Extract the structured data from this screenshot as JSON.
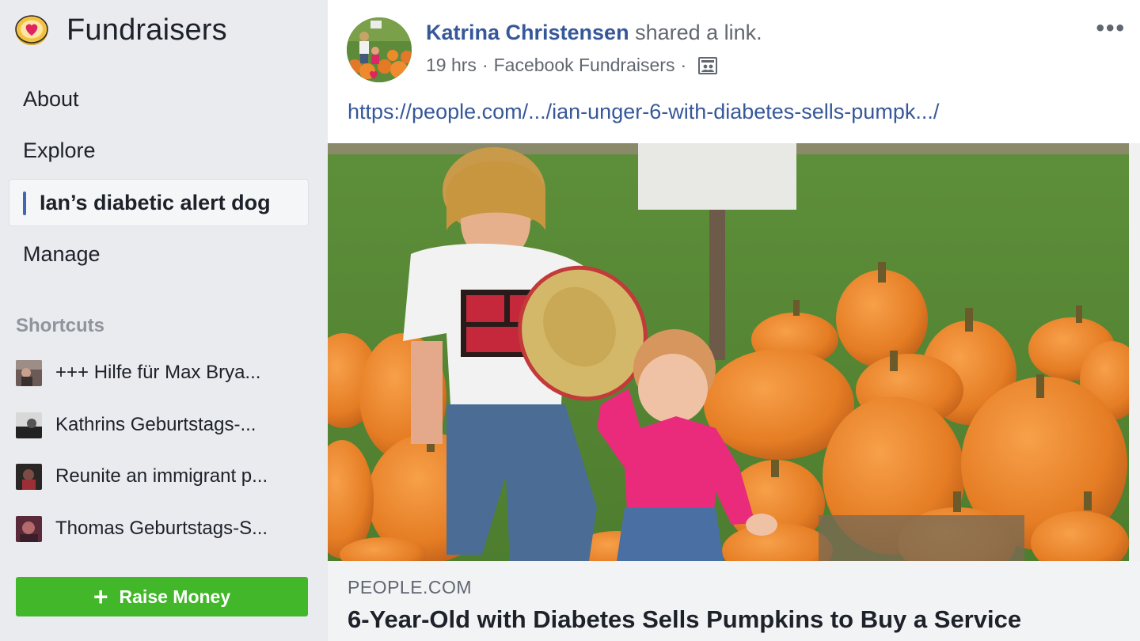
{
  "sidebar": {
    "icon": "fundraiser-heart-coin-icon",
    "title": "Fundraisers",
    "nav": [
      {
        "label": "About"
      },
      {
        "label": "Explore"
      },
      {
        "label": "Ian’s diabetic alert dog",
        "active": true
      },
      {
        "label": "Manage"
      }
    ],
    "shortcuts_title": "Shortcuts",
    "shortcuts": [
      {
        "label": "+++ Hilfe für Max Brya..."
      },
      {
        "label": "Kathrins Geburtstags-..."
      },
      {
        "label": "Reunite an immigrant p..."
      },
      {
        "label": "Thomas Geburtstags-S..."
      }
    ],
    "raise_button": {
      "icon": "plus-icon",
      "label": "Raise Money"
    }
  },
  "post": {
    "author": "Katrina Christensen",
    "action": "shared a link.",
    "time": "19 hrs",
    "source": "Facebook Fundraisers",
    "audience_icon": "public-photo-icon",
    "more_icon": "more-options-icon",
    "url": "https://people.com/.../ian-unger-6-with-diabetes-sells-pumpk.../",
    "link_preview": {
      "domain": "PEOPLE.COM",
      "headline": "6-Year-Old with Diabetes Sells Pumpkins to Buy a Service"
    }
  },
  "colors": {
    "link_blue": "#365899",
    "active_bar": "#4267b2",
    "raise_green": "#42b72a",
    "background": "#e9ebee"
  }
}
